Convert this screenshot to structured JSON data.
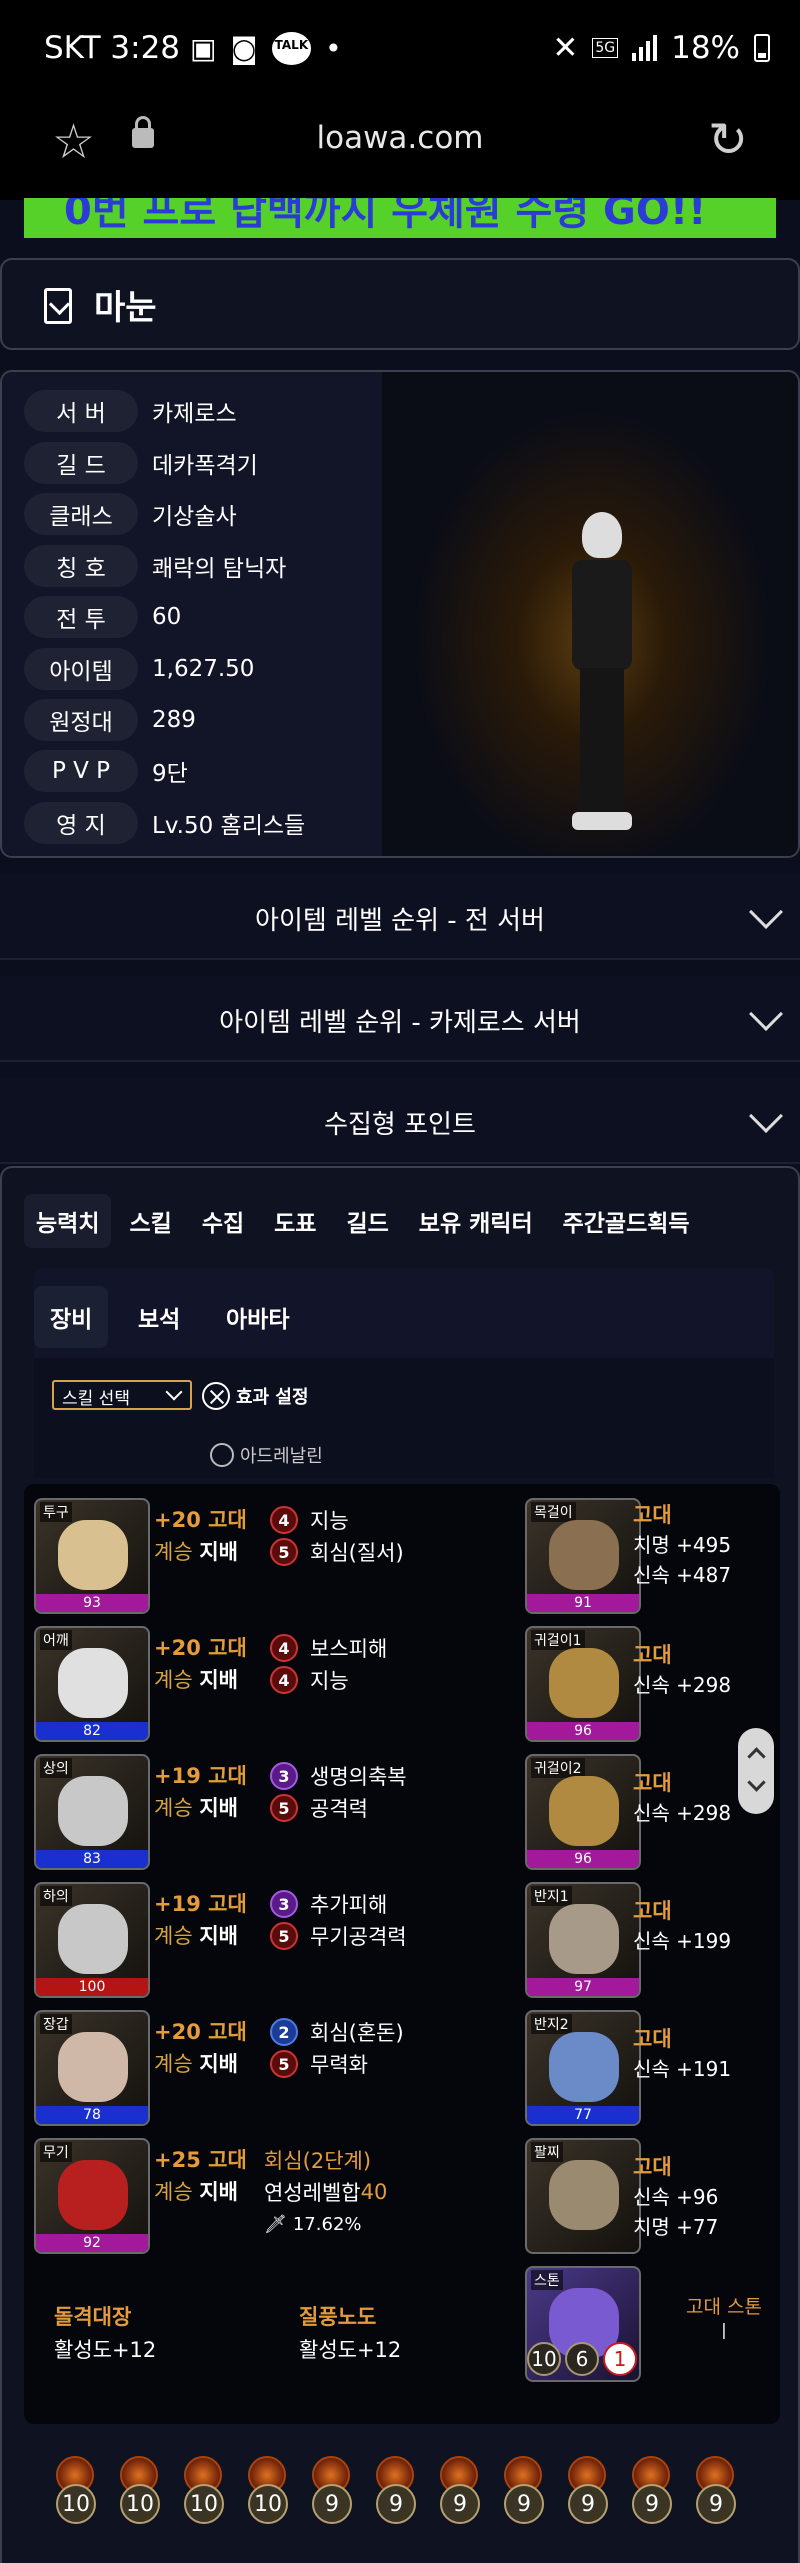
{
  "status": {
    "carrier": "SKT",
    "time": "3:28",
    "battery": "18%",
    "talk": "TALK",
    "network": "5G"
  },
  "browser": {
    "url": "loawa.com"
  },
  "banner": {
    "text": "0번 프로 답백까지 우체원 수령 GO!!"
  },
  "character": {
    "name": "마눈"
  },
  "info": [
    {
      "key": "서 버",
      "value": "카제로스"
    },
    {
      "key": "길 드",
      "value": "데카폭격기"
    },
    {
      "key": "클래스",
      "value": "기상술사"
    },
    {
      "key": "칭 호",
      "value": "쾌락의 탐닉자"
    },
    {
      "key": "전 투",
      "value": "60"
    },
    {
      "key": "아이템",
      "value": "1,627.50"
    },
    {
      "key": "원정대",
      "value": "289"
    },
    {
      "key": "P V P",
      "value": "9단"
    },
    {
      "key": "영 지",
      "value": "Lv.50 홈리스들"
    }
  ],
  "accordions": [
    "아이템 레벨 순위 - 전 서버",
    "아이템 레벨 순위 - 카제로스 서버",
    "수집형 포인트"
  ],
  "tabs": [
    "능력치",
    "스킬",
    "수집",
    "도표",
    "길드",
    "보유 캐릭터",
    "주간골드획득"
  ],
  "subtabs": [
    "장비",
    "보석",
    "아바타"
  ],
  "filters": {
    "skill_select": "스킬 선택",
    "effect_setting": "효과 설정",
    "adrenaline": "아드레날린"
  },
  "equipment": [
    {
      "slot": "투구",
      "quality": "93",
      "upgrade": "+20 고대",
      "set": "계승",
      "set_name": "지배",
      "effects": [
        {
          "lv": "4",
          "name": "지능",
          "color": "red"
        },
        {
          "lv": "5",
          "name": "회심(질서)",
          "color": "red"
        }
      ]
    },
    {
      "slot": "어깨",
      "quality": "82",
      "upgrade": "+20 고대",
      "set": "계승",
      "set_name": "지배",
      "effects": [
        {
          "lv": "4",
          "name": "보스피해",
          "color": "red"
        },
        {
          "lv": "4",
          "name": "지능",
          "color": "red"
        }
      ]
    },
    {
      "slot": "상의",
      "quality": "83",
      "upgrade": "+19 고대",
      "set": "계승",
      "set_name": "지배",
      "effects": [
        {
          "lv": "3",
          "name": "생명의축복",
          "color": "purple"
        },
        {
          "lv": "5",
          "name": "공격력",
          "color": "red"
        }
      ]
    },
    {
      "slot": "하의",
      "quality": "100",
      "upgrade": "+19 고대",
      "set": "계승",
      "set_name": "지배",
      "effects": [
        {
          "lv": "3",
          "name": "추가피해",
          "color": "purple"
        },
        {
          "lv": "5",
          "name": "무기공격력",
          "color": "red"
        }
      ]
    },
    {
      "slot": "장갑",
      "quality": "78",
      "upgrade": "+20 고대",
      "set": "계승",
      "set_name": "지배",
      "effects": [
        {
          "lv": "2",
          "name": "회심(혼돈)",
          "color": "blue"
        },
        {
          "lv": "5",
          "name": "무력화",
          "color": "red"
        }
      ]
    }
  ],
  "weapon": {
    "slot": "무기",
    "quality": "92",
    "upgrade": "+25 고대",
    "set": "계승",
    "set_name": "지배",
    "elixir": "회심(2단계)",
    "elixir_total_label": "연성레벨합",
    "elixir_total": "40",
    "transcend": "17.62%"
  },
  "accessories": [
    {
      "slot": "목걸이",
      "quality": "91",
      "grade": "고대",
      "stats": [
        "치명 +495",
        "신속 +487"
      ]
    },
    {
      "slot": "귀걸이1",
      "quality": "96",
      "grade": "고대",
      "stats": [
        "신속 +298"
      ]
    },
    {
      "slot": "귀걸이2",
      "quality": "96",
      "grade": "고대",
      "stats": [
        "신속 +298"
      ]
    },
    {
      "slot": "반지1",
      "quality": "97",
      "grade": "고대",
      "stats": [
        "신속 +199"
      ]
    },
    {
      "slot": "반지2",
      "quality": "77",
      "grade": "고대",
      "stats": [
        "신속 +191"
      ]
    },
    {
      "slot": "팔찌",
      "quality": "",
      "grade": "고대",
      "stats": [
        "신속 +96",
        "치명 +77"
      ]
    }
  ],
  "ark": [
    {
      "name": "돌격대장",
      "value": "활성도+12"
    },
    {
      "name": "질풍노도",
      "value": "활성도+12"
    }
  ],
  "stone": {
    "slot": "스톤",
    "label": "고대 스톤",
    "sub": "|",
    "nums": [
      "10",
      "6",
      "1"
    ]
  },
  "gems": [
    "10",
    "10",
    "10",
    "10",
    "9",
    "9",
    "9",
    "9",
    "9",
    "9",
    "9"
  ],
  "colors": {
    "accent_orange": "#e39b3c",
    "quality_purple": "#a21a9a",
    "quality_blue": "#1a2fd0",
    "quality_red": "#b51414"
  },
  "quality_colors": [
    "purple",
    "blue",
    "blue",
    "red",
    "blue",
    "purple"
  ],
  "acc_quality_colors": [
    "purple",
    "purple",
    "purple",
    "purple",
    "blue",
    ""
  ]
}
